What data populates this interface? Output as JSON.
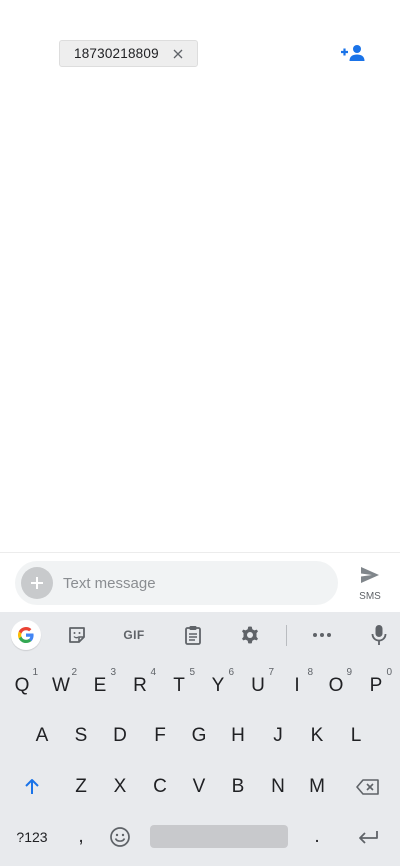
{
  "recipient": {
    "number": "18730218809",
    "remove_icon": "close-icon",
    "add_contact_icon": "person-add-icon",
    "accent_color": "#1a73e8"
  },
  "compose": {
    "placeholder": "Text message",
    "attach_icon": "plus-icon",
    "send_icon": "send-icon",
    "send_label": "SMS"
  },
  "keyboard": {
    "toolbar": [
      {
        "name": "google-icon"
      },
      {
        "name": "sticker-icon"
      },
      {
        "name": "gif-button",
        "label": "GIF"
      },
      {
        "name": "clipboard-icon"
      },
      {
        "name": "gear-icon"
      },
      {
        "name": "more-icon"
      },
      {
        "name": "mic-icon"
      }
    ],
    "row1": [
      {
        "label": "Q",
        "hint": "1"
      },
      {
        "label": "W",
        "hint": "2"
      },
      {
        "label": "E",
        "hint": "3"
      },
      {
        "label": "R",
        "hint": "4"
      },
      {
        "label": "T",
        "hint": "5"
      },
      {
        "label": "Y",
        "hint": "6"
      },
      {
        "label": "U",
        "hint": "7"
      },
      {
        "label": "I",
        "hint": "8"
      },
      {
        "label": "O",
        "hint": "9"
      },
      {
        "label": "P",
        "hint": "0"
      }
    ],
    "row2": [
      "A",
      "S",
      "D",
      "F",
      "G",
      "H",
      "J",
      "K",
      "L"
    ],
    "row3": [
      "Z",
      "X",
      "C",
      "V",
      "B",
      "N",
      "M"
    ],
    "shift_icon": "shift-arrow-icon",
    "backspace_icon": "backspace-icon",
    "row4": {
      "symbols_label": "?123",
      "comma_label": ",",
      "emoji_icon": "emoji-icon",
      "period_label": ".",
      "enter_icon": "enter-icon"
    }
  }
}
